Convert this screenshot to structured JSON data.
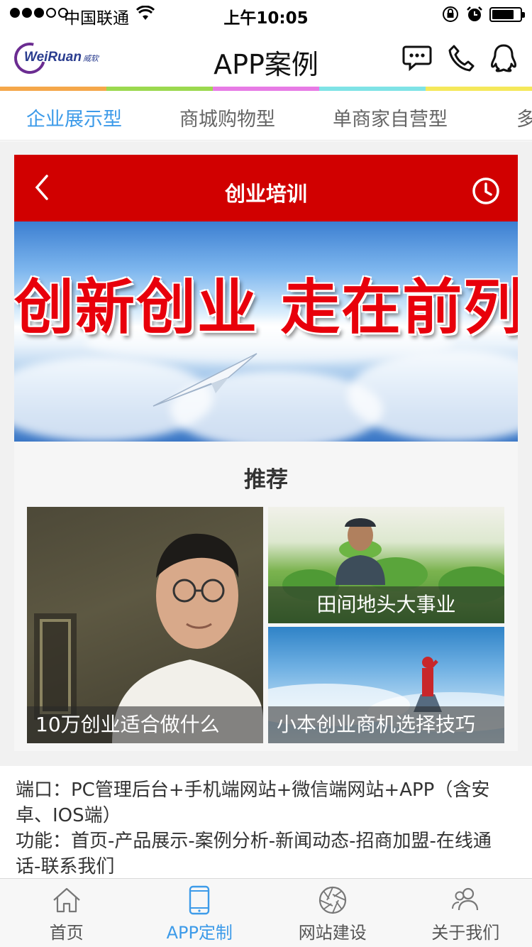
{
  "status_bar": {
    "carrier": "中国联通",
    "time": "上午10:05",
    "signal_bars_filled": 3,
    "signal_bars_total": 5,
    "battery_level": 0.8
  },
  "header": {
    "logo_text": "WeiRuan",
    "logo_sub": "威软",
    "title": "APP案例",
    "icons": [
      "chat-icon",
      "phone-icon",
      "qq-icon"
    ]
  },
  "rainbow_colors": [
    "#f5a74a",
    "#9bd94f",
    "#e77be5",
    "#7fe3e6",
    "#f5e85a"
  ],
  "tabs": [
    {
      "label": "企业展示型",
      "active": true
    },
    {
      "label": "商城购物型",
      "active": false
    },
    {
      "label": "单商家自营型",
      "active": false
    },
    {
      "label": "多",
      "active": false
    }
  ],
  "preview": {
    "title": "创业培训",
    "banner_text": "创新创业  走在前列",
    "carousel": {
      "count": 3,
      "active": 0
    },
    "section_title": "推荐",
    "tiles": [
      {
        "caption": "10万创业适合做什么"
      },
      {
        "caption": "田间地头大事业"
      },
      {
        "caption": "小本创业商机选择技巧"
      }
    ]
  },
  "description": {
    "line1": "端口：PC管理后台+手机端网站+微信端网站+APP（含安卓、IOS端）",
    "line2": "功能：首页-产品展示-案例分析-新闻动态-招商加盟-在线通话-联系我们"
  },
  "bottom_nav": [
    {
      "label": "首页",
      "icon": "home-icon",
      "active": false
    },
    {
      "label": "APP定制",
      "icon": "phone-app-icon",
      "active": true
    },
    {
      "label": "网站建设",
      "icon": "aperture-icon",
      "active": false
    },
    {
      "label": "关于我们",
      "icon": "people-icon",
      "active": false
    }
  ],
  "colors": {
    "accent": "#3d9be9",
    "preview_red": "#d10000"
  }
}
